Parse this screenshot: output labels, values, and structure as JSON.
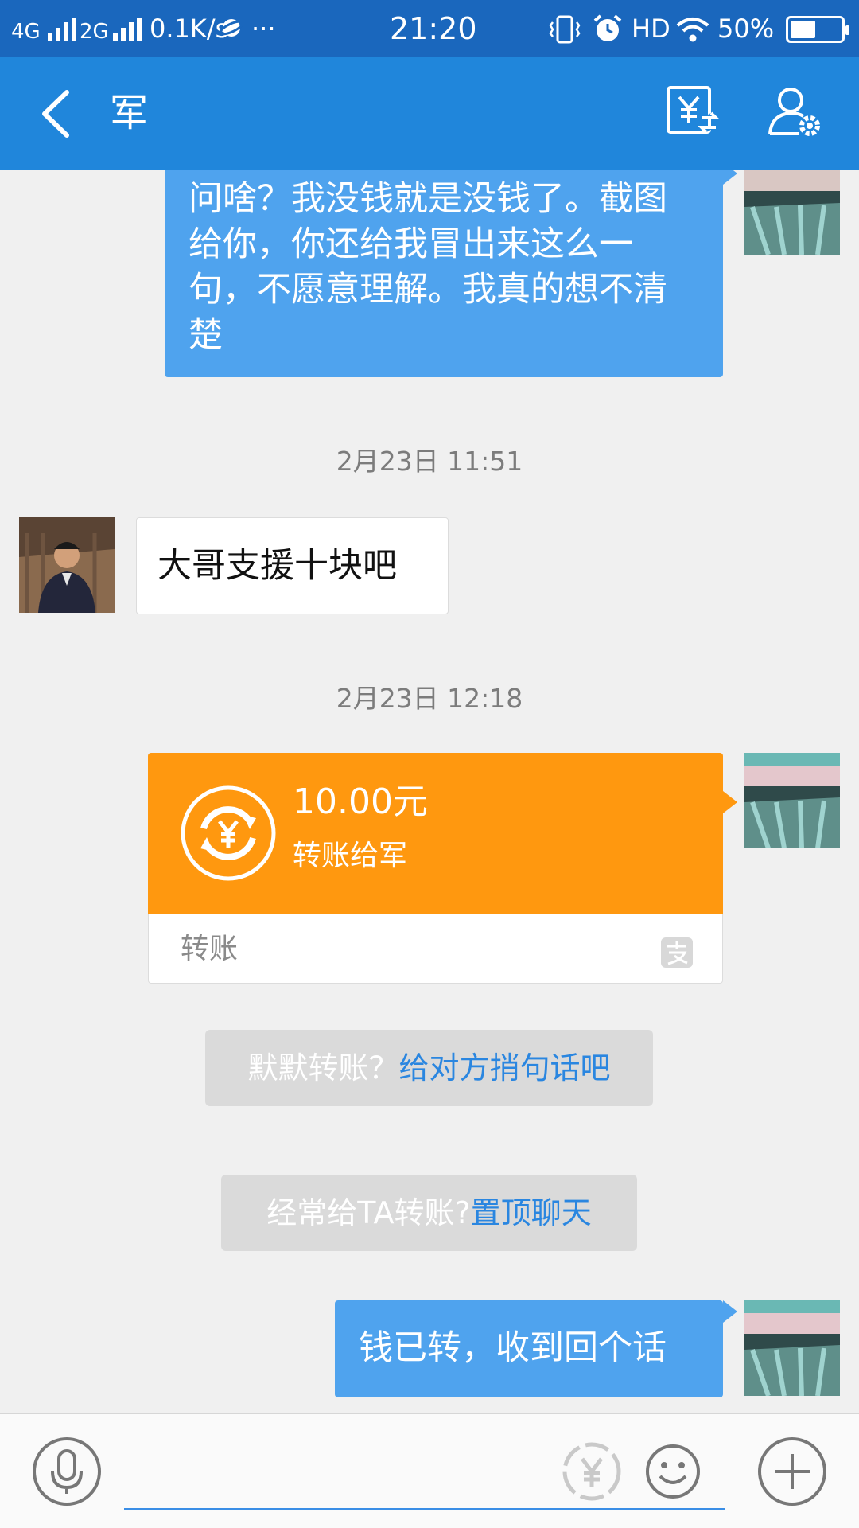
{
  "status_bar": {
    "network1": "4G",
    "network2": "2G",
    "speed": "0.1K/s",
    "more": "···",
    "time": "21:20",
    "hd": "HD",
    "battery_percent_text": "50%",
    "battery_level": 0.5
  },
  "header": {
    "title": "军"
  },
  "messages": {
    "m1_text": "问啥？我没钱就是没钱了。截图给你，你还给我冒出来这么一句，不愿意理解。我真的想不清楚",
    "ts1": "2月23日 11:51",
    "m2_text": "大哥支援十块吧",
    "ts2": "2月23日 12:18",
    "transfer": {
      "amount": "10.00元",
      "desc": "转账给军",
      "label": "转账"
    },
    "sys1": {
      "prefix": "默默转账？",
      "link": "给对方捎句话吧"
    },
    "sys2": {
      "prefix": "经常给TA转账?",
      "link": "置顶聊天"
    },
    "m3_text": "钱已转，收到回个话"
  },
  "colors": {
    "status_bar": "#1a67bd",
    "title_bar": "#2086db",
    "outgoing_bubble": "#4fa3ee",
    "transfer_orange": "#ff980f",
    "link_blue": "#2a86e0"
  },
  "icons": {
    "back": "chevron-left-icon",
    "transfer": "transfer-yen-icon",
    "profile": "profile-settings-icon",
    "mic": "microphone-icon",
    "yen": "yen-icon",
    "emoji": "smiley-icon",
    "plus": "plus-icon"
  }
}
